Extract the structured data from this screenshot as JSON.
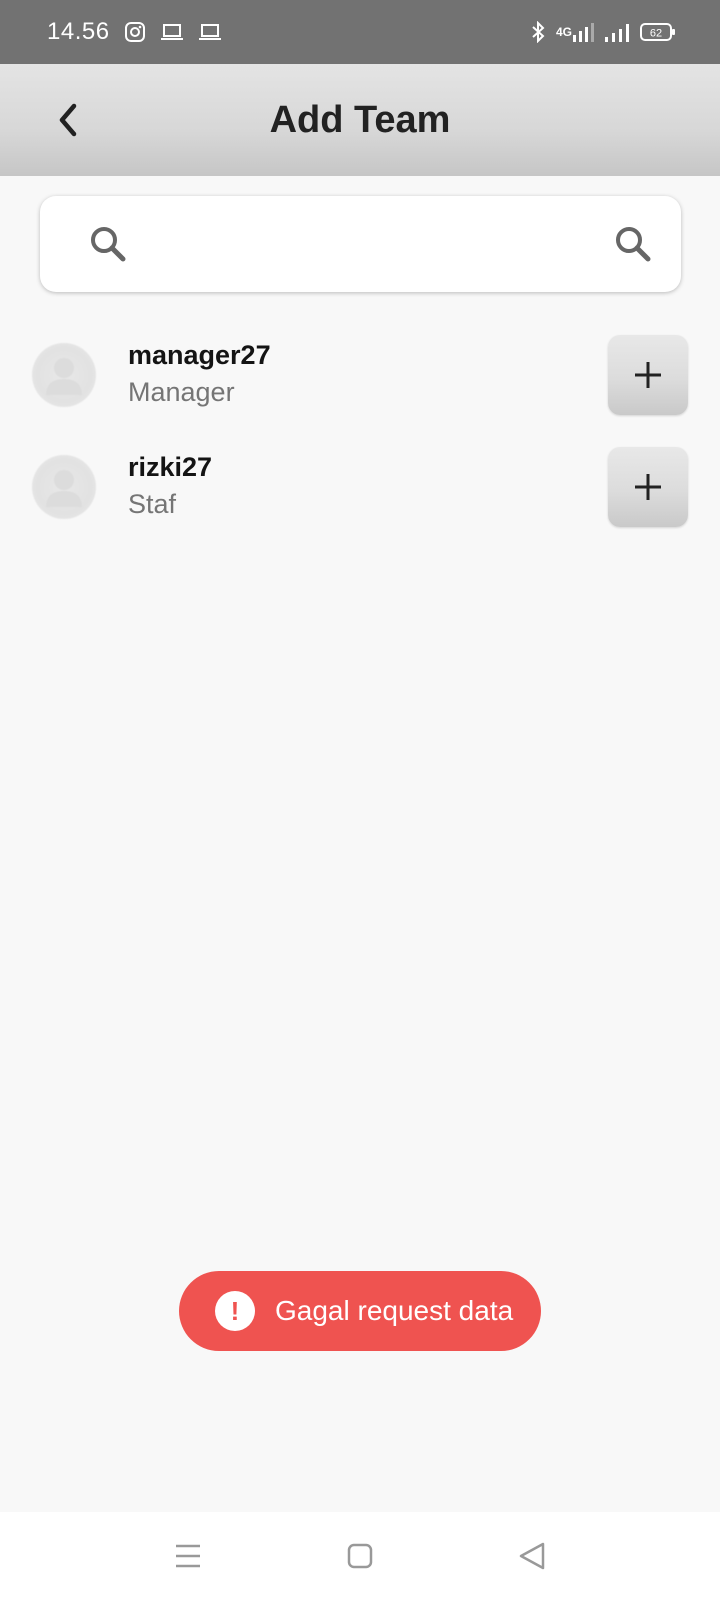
{
  "status_bar": {
    "time": "14.56",
    "network": "4G",
    "battery": "62",
    "left_icons": [
      "instagram-icon",
      "laptop-icon",
      "laptop-icon"
    ],
    "right_icons": [
      "bluetooth-icon",
      "mobile-data-signal-icon",
      "wifi-signal-icon",
      "battery-icon"
    ]
  },
  "app_bar": {
    "title": "Add Team",
    "back_icon": "chevron-left-icon"
  },
  "search": {
    "value": "",
    "placeholder": "",
    "leading_icon": "search-icon",
    "trailing_icon": "search-icon"
  },
  "members": [
    {
      "name": "manager27",
      "role": "Manager",
      "action_icon": "plus-icon"
    },
    {
      "name": "rizki27",
      "role": "Staf",
      "action_icon": "plus-icon"
    }
  ],
  "toast": {
    "icon": "exclamation-icon",
    "symbol": "!",
    "message": "Gagal request data",
    "color": "#ef5350"
  },
  "nav_bar": {
    "icons": [
      "menu-icon",
      "home-square-icon",
      "back-triangle-icon"
    ]
  }
}
